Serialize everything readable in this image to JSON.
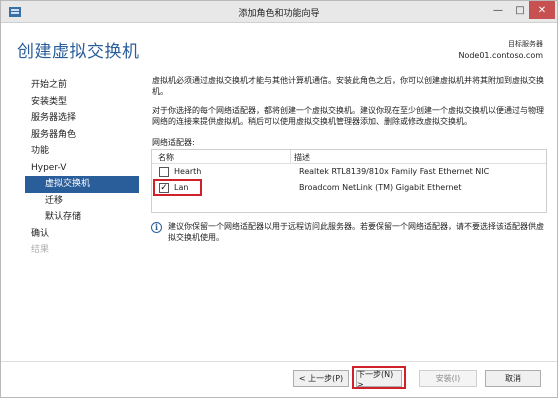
{
  "window": {
    "title": "添加角色和功能向导"
  },
  "page": {
    "title": "创建虚拟交换机",
    "server_label": "目标服务器",
    "server_name": "Node01.contoso.com"
  },
  "nav": {
    "items": [
      {
        "label": "开始之前"
      },
      {
        "label": "安装类型"
      },
      {
        "label": "服务器选择"
      },
      {
        "label": "服务器角色"
      },
      {
        "label": "功能"
      },
      {
        "label": "Hyper-V"
      },
      {
        "label": "虚拟交换机"
      },
      {
        "label": "迁移"
      },
      {
        "label": "默认存储"
      },
      {
        "label": "确认"
      },
      {
        "label": "结果"
      }
    ]
  },
  "content": {
    "para1": "虚拟机必须通过虚拟交换机才能与其他计算机通信。安装此角色之后，你可以创建虚拟机并将其附加到虚拟交换机。",
    "para2": "对于你选择的每个网络适配器，都将创建一个虚拟交换机。建议你现在至少创建一个虚拟交换机以便通过与物理网络的连接来提供虚拟机。稍后可以使用虚拟交换机管理器添加、删除或修改虚拟交换机。",
    "adapters_label": "网络适配器:",
    "col_name": "名称",
    "col_desc": "描述",
    "adapters": [
      {
        "name": "Hearth",
        "desc": "Realtek RTL8139/810x Family Fast Ethernet NIC",
        "checked": false
      },
      {
        "name": "Lan",
        "desc": "Broadcom NetLink (TM) Gigabit Ethernet",
        "checked": true
      }
    ],
    "note": "建议你保留一个网络适配器以用于远程访问此服务器。若要保留一个网络适配器，请不要选择该适配器供虚拟交换机使用。"
  },
  "footer": {
    "prev": "< 上一步(P)",
    "next": "下一步(N) >",
    "install": "安装(I)",
    "cancel": "取消"
  },
  "colors": {
    "accent": "#2a5e9a",
    "highlight": "#d0202a",
    "close_button": "#c75050"
  },
  "icons": {
    "app": "server-manager-icon",
    "info": "info-icon"
  }
}
